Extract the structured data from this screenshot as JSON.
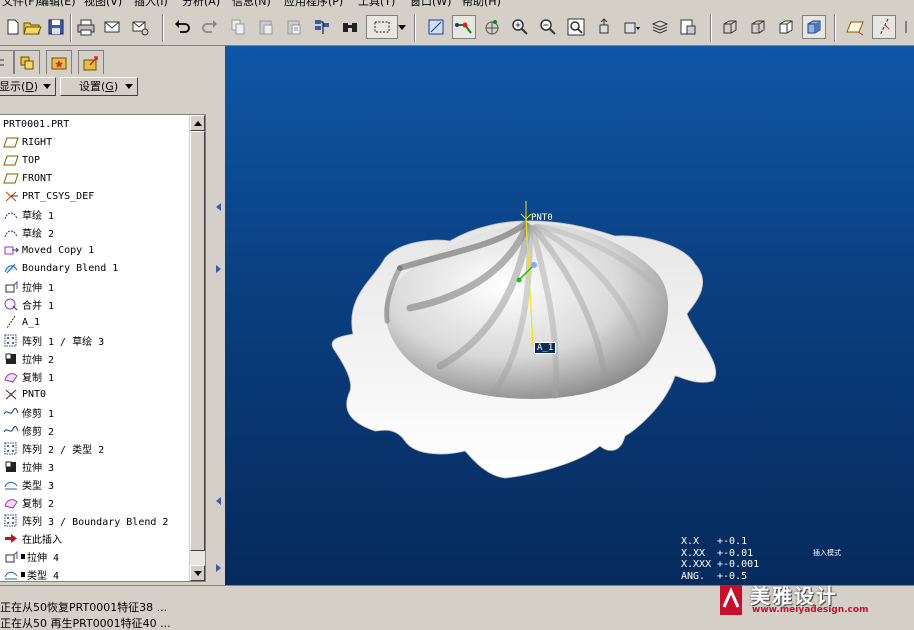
{
  "menu": [
    "文件(F)",
    "编辑(E)",
    "视图(V)",
    "插入(I)",
    "分析(A)",
    "信息(N)",
    "应用程序(P)",
    "工具(T)",
    "窗口(W)",
    "帮助(H)"
  ],
  "toolbar_icons": [
    "new-icon",
    "open-icon",
    "save-icon",
    "print-icon",
    "email-icon",
    "email-link-icon",
    "undo-icon",
    "redo-icon",
    "copy-icon",
    "paste-icon",
    "paste-special-icon",
    "regenerate-icon",
    "find-icon",
    "select-box-icon",
    "select-dropdown-icon",
    "sketch-view-icon",
    "datum-display-icon",
    "spin-center-icon",
    "zoom-in-icon",
    "zoom-out-icon",
    "refit-icon",
    "reorient-icon",
    "saved-views-icon",
    "layers-icon",
    "view-manager-icon",
    "wireframe-icon",
    "hidden-line-icon",
    "no-hidden-icon",
    "shading-icon",
    "datum-plane-icon",
    "datum-axis-icon"
  ],
  "panel": {
    "show_label": "显示",
    "show_shortcut": "D",
    "settings_label": "设置",
    "settings_shortcut": "G",
    "tab_icons": [
      "model-tree-tab-icon",
      "folder-browser-tab-icon",
      "favorites-tab-icon",
      "connections-tab-icon"
    ]
  },
  "tree": {
    "root": "PRT0001.PRT",
    "items": [
      {
        "label": "RIGHT",
        "icon": "datum-plane-icon"
      },
      {
        "label": "TOP",
        "icon": "datum-plane-icon"
      },
      {
        "label": "FRONT",
        "icon": "datum-plane-icon"
      },
      {
        "label": "PRT_CSYS_DEF",
        "icon": "csys-icon"
      },
      {
        "label": "草绘 1",
        "icon": "sketch-icon"
      },
      {
        "label": "草绘 2",
        "icon": "sketch-icon"
      },
      {
        "label": "Moved Copy 1",
        "icon": "moved-copy-icon"
      },
      {
        "label": "Boundary Blend 1",
        "icon": "boundary-blend-icon"
      },
      {
        "label": "拉伸 1",
        "icon": "extrude-icon"
      },
      {
        "label": "合并 1",
        "icon": "merge-icon"
      },
      {
        "label": "A_1",
        "icon": "datum-axis-icon"
      },
      {
        "label": "阵列 1 / 草绘 3",
        "icon": "pattern-icon"
      },
      {
        "label": "拉伸 2",
        "icon": "extrude-solid-icon"
      },
      {
        "label": "复制 1",
        "icon": "copy-feature-icon"
      },
      {
        "label": "PNT0",
        "icon": "datum-point-icon"
      },
      {
        "label": "修剪 1",
        "icon": "trim-icon"
      },
      {
        "label": "修剪 2",
        "icon": "trim-icon"
      },
      {
        "label": "阵列 2 / 类型 2",
        "icon": "pattern-icon"
      },
      {
        "label": "拉伸 3",
        "icon": "extrude-solid-icon"
      },
      {
        "label": "类型 3",
        "icon": "type-icon"
      },
      {
        "label": "复制 2",
        "icon": "copy-feature-icon"
      },
      {
        "label": "阵列 3 / Boundary Blend 2",
        "icon": "pattern-icon"
      },
      {
        "label": "在此插入",
        "icon": "insert-here-icon"
      },
      {
        "label": "拉伸 4",
        "icon": "extrude-icon",
        "suppressed": true
      },
      {
        "label": "类型 4",
        "icon": "type-icon",
        "suppressed": true
      }
    ]
  },
  "viewport": {
    "point_label": "PNT0",
    "axis_label": "A_1",
    "precision": [
      {
        "key": "X.X",
        "value": "+-0.1"
      },
      {
        "key": "X.XX",
        "value": "+-0.01"
      },
      {
        "key": "X.XXX",
        "value": "+-0.001"
      },
      {
        "key": "ANG.",
        "value": "+-0.5"
      }
    ],
    "insert_mode": "插入模式"
  },
  "status": {
    "messages": [
      "正在从50恢复PRT0001特征38 ...",
      "正在从50 再生PRT0001特征40 ..."
    ]
  },
  "watermark": {
    "name": "美雅设计",
    "url": "www.meiyadesign.com"
  },
  "colors": {
    "viewport_top": "#0e57a6",
    "viewport_bottom": "#062a5c",
    "model_light": "#f2f2f2",
    "model_dark": "#6b6b6b",
    "axis_yellow": "#f2e600"
  }
}
